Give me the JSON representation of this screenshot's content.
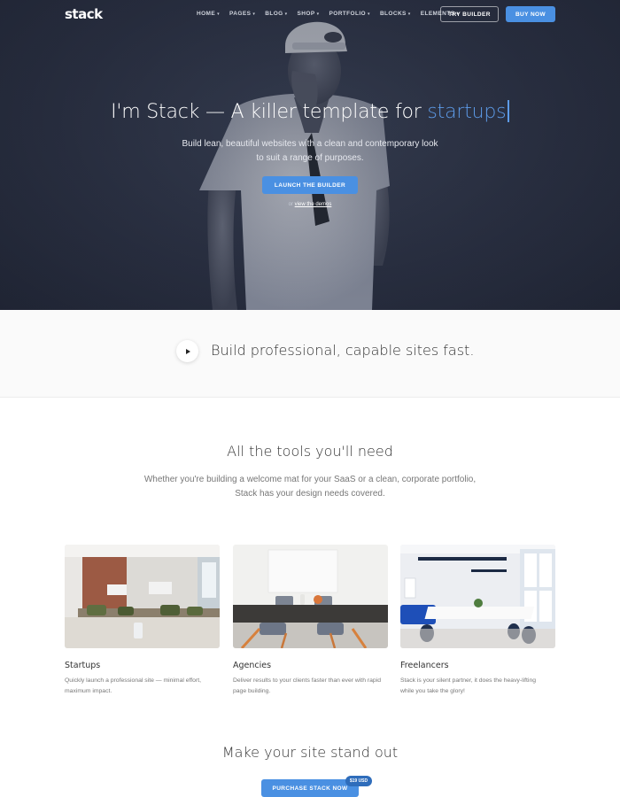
{
  "brand": {
    "logo": "stack",
    "accent": "#4a90e2"
  },
  "nav": {
    "items": [
      {
        "label": "HOME"
      },
      {
        "label": "PAGES"
      },
      {
        "label": "BLOG"
      },
      {
        "label": "SHOP"
      },
      {
        "label": "PORTFOLIO"
      },
      {
        "label": "BLOCKS"
      },
      {
        "label": "ELEMENTS"
      }
    ],
    "caret_icon": "chevron-down-icon",
    "try_label": "TRY BUILDER",
    "buy_label": "BUY NOW"
  },
  "hero": {
    "title_prefix": "I'm Stack — A killer template for ",
    "title_accent": "startups",
    "subtitle": "Build lean, beautiful websites with a clean and contemporary look to suit a range of purposes.",
    "cta_label": "LAUNCH THE BUILDER",
    "alt_prefix": "or ",
    "alt_link": "view the demos"
  },
  "strip": {
    "play_icon": "play-icon",
    "text": "Build professional, capable sites fast."
  },
  "tools": {
    "title": "All the tools you'll need",
    "subtitle": "Whether you're building a welcome mat for your SaaS or a clean, corporate portfolio, Stack has your design needs covered.",
    "cards": [
      {
        "title": "Startups",
        "text": "Quickly launch a professional site — minimal effort, maximum impact."
      },
      {
        "title": "Agencies",
        "text": "Deliver results to your clients faster than ever with rapid page building."
      },
      {
        "title": "Freelancers",
        "text": "Stack is your silent partner, it does the heavy-lifting while you take the glory!"
      }
    ]
  },
  "standout": {
    "title": "Make your site stand out",
    "cta_label": "PURCHASE STACK NOW",
    "price_badge": "$19 USD"
  }
}
